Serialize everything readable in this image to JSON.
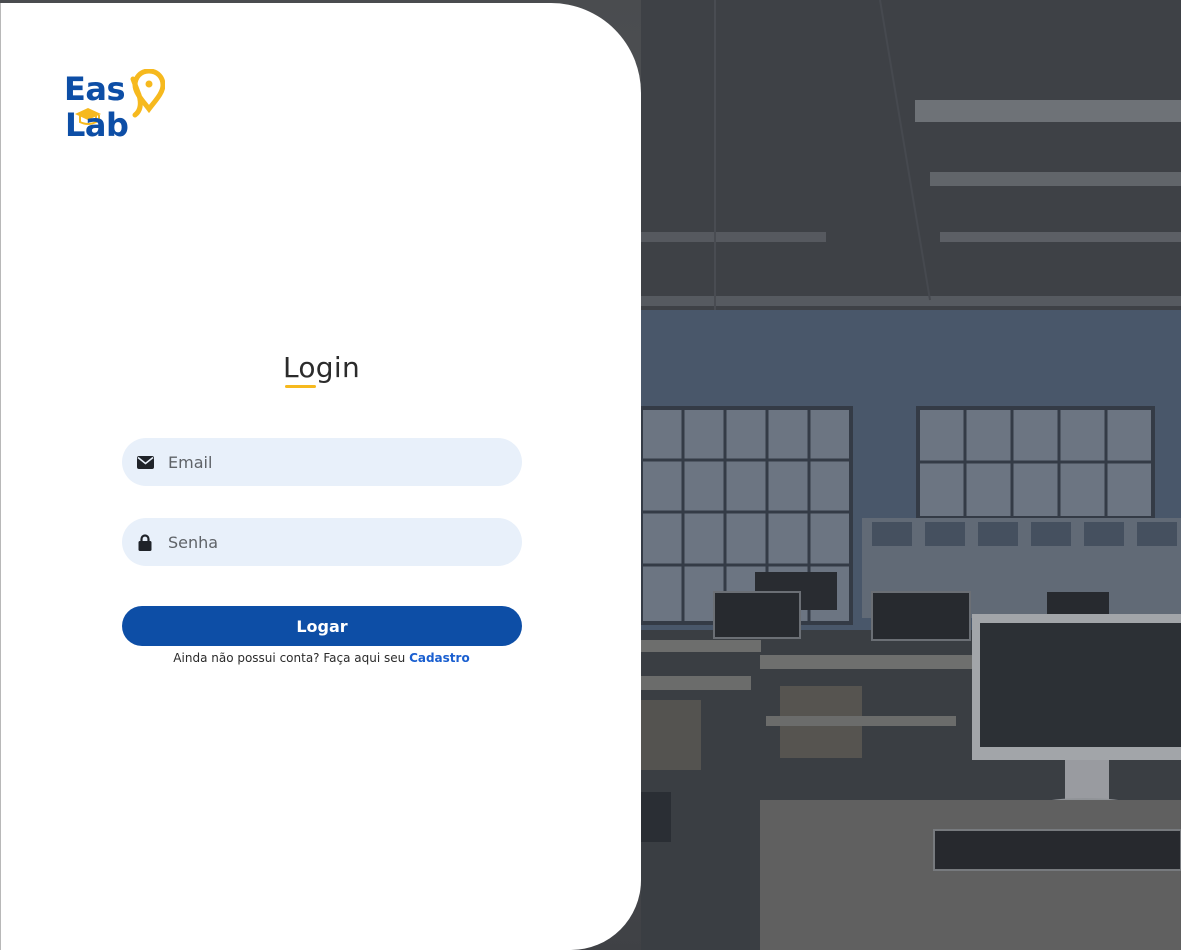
{
  "logo": {
    "line1": "Eas",
    "line2": "Lab"
  },
  "login": {
    "title": "Login",
    "email_placeholder": "Email",
    "password_placeholder": "Senha",
    "submit_label": "Logar",
    "signup_prompt": "Ainda não possui conta? Faça aqui seu",
    "signup_link": "Cadastro"
  },
  "colors": {
    "brand_blue": "#0d4ea6",
    "brand_yellow": "#f6b91e",
    "input_bg": "#e8f0fa",
    "link_blue": "#1a5fd0"
  },
  "icons": {
    "email": "envelope-icon",
    "password": "lock-icon"
  }
}
